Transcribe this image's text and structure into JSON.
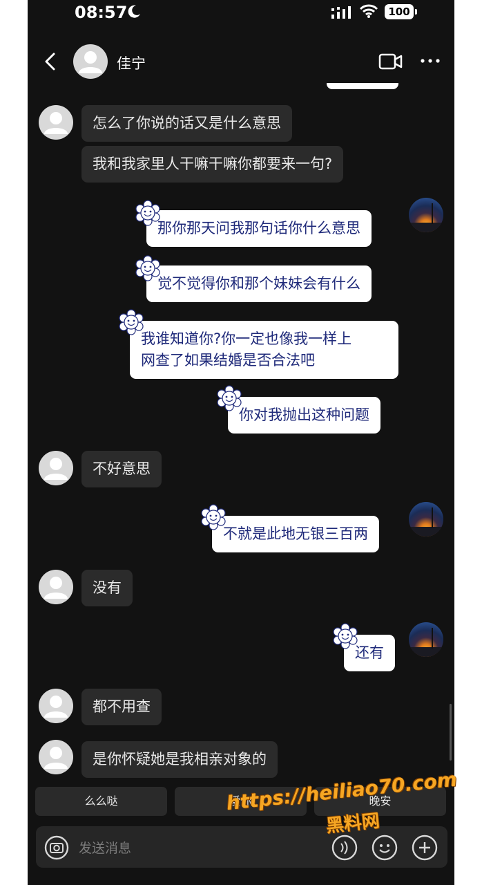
{
  "status_bar": {
    "time": "08:57",
    "battery": "100"
  },
  "header": {
    "contact_name": "佳宁"
  },
  "messages": [
    {
      "side": "in",
      "text": "怎么了你说的话又是什么意思"
    },
    {
      "side": "in",
      "text": "我和我家里人干嘛干嘛你都要来一句?"
    },
    {
      "side": "out",
      "text": "那你那天问我那句话你什么意思"
    },
    {
      "side": "out",
      "text": "觉不觉得你和那个妹妹会有什么"
    },
    {
      "side": "out",
      "text_line1": "我谁知道你?你一定也像我一样上",
      "text_line2": "网查了如果结婚是否合法吧"
    },
    {
      "side": "out",
      "text": "你对我抛出这种问题"
    },
    {
      "side": "in",
      "text": "不好意思"
    },
    {
      "side": "out",
      "text": "不就是此地无银三百两"
    },
    {
      "side": "in",
      "text": "没有"
    },
    {
      "side": "out",
      "text": "还有"
    },
    {
      "side": "in",
      "text": "都不用查"
    },
    {
      "side": "in",
      "text": "是你怀疑她是我相亲对象的"
    }
  ],
  "quick_replies": [
    "么么哒",
    "爱你",
    "晚安"
  ],
  "input": {
    "placeholder": "发送消息"
  },
  "watermark": {
    "line1": "https://heiliao70.com",
    "line2": "黑料网"
  },
  "icons": {
    "back": "chevron-left-icon",
    "video": "video-camera-icon",
    "more": "more-dots-icon",
    "camera": "camera-icon",
    "voice": "voice-icon",
    "emoji": "emoji-icon",
    "plus": "plus-icon"
  }
}
